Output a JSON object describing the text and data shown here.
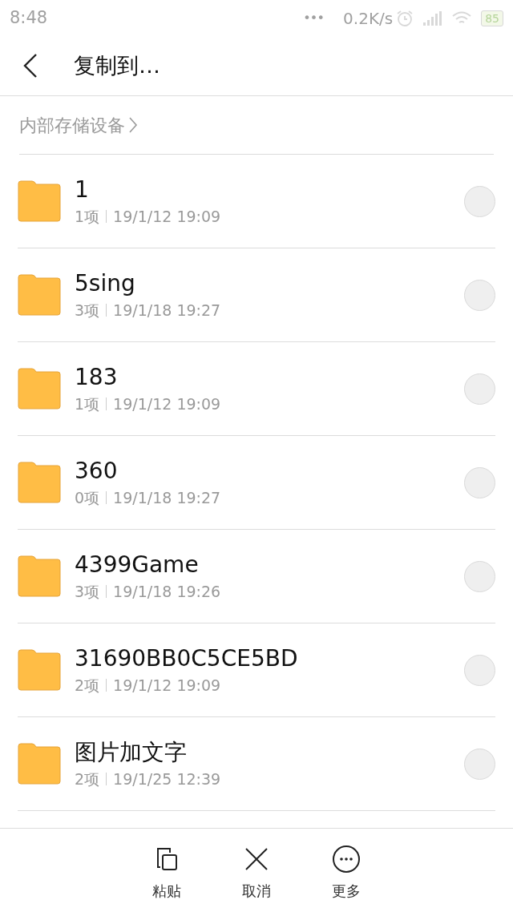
{
  "status_bar": {
    "time": "8:48",
    "dots": "•••",
    "speed": "0.2K/s",
    "battery": "85"
  },
  "header": {
    "title": "复制到…"
  },
  "breadcrumb": {
    "path": "内部存储设备"
  },
  "folders": [
    {
      "name": "1",
      "count": "1项",
      "date": "19/1/12 19:09",
      "selected": false
    },
    {
      "name": "5sing",
      "count": "3项",
      "date": "19/1/18 19:27",
      "selected": false
    },
    {
      "name": "183",
      "count": "1项",
      "date": "19/1/12 19:09",
      "selected": false
    },
    {
      "name": "360",
      "count": "0项",
      "date": "19/1/18 19:27",
      "selected": false
    },
    {
      "name": "4399Game",
      "count": "3项",
      "date": "19/1/18 19:26",
      "selected": false
    },
    {
      "name": "31690BB0C5CE5BD",
      "count": "2项",
      "date": "19/1/12 19:09",
      "selected": false
    },
    {
      "name": "图片加文字",
      "count": "2项",
      "date": "19/1/25 12:39",
      "selected": false
    }
  ],
  "bottom_bar": [
    {
      "kind": "paste",
      "label": "粘贴"
    },
    {
      "kind": "cancel",
      "label": "取消"
    },
    {
      "kind": "more",
      "label": "更多"
    }
  ]
}
